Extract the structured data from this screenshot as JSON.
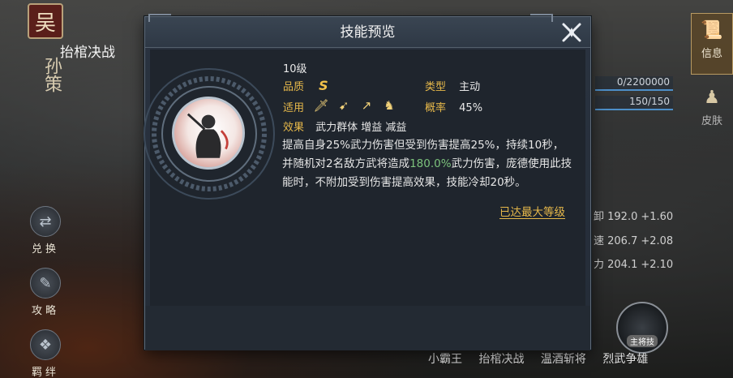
{
  "background": {
    "hero": {
      "seal_char": "吴",
      "name": "孙策"
    },
    "side_buttons": [
      {
        "label": "兑换",
        "icon": "exchange-icon"
      },
      {
        "label": "攻略",
        "icon": "strategy-icon"
      },
      {
        "label": "羁绊",
        "icon": "bond-icon"
      }
    ],
    "right_tabs": [
      {
        "label": "信息",
        "icon": "scroll-icon"
      },
      {
        "label": "皮肤",
        "icon": "figure-icon"
      }
    ],
    "bars": [
      {
        "text": "0/2200000"
      },
      {
        "text": "150/150"
      }
    ],
    "stats": [
      {
        "value": "卸 192.0",
        "delta": "+1.60"
      },
      {
        "value": "速 206.7",
        "delta": "+2.08"
      },
      {
        "value": "力 204.1",
        "delta": "+2.10"
      }
    ],
    "skill_tabs": [
      "小霸王",
      "抬棺决战",
      "温酒斩将",
      "烈武争雄"
    ],
    "lord_skill_badge": "主将技"
  },
  "modal": {
    "title": "技能预览",
    "skill_name": "抬棺决战",
    "level": "10级",
    "quality_label": "品质",
    "quality_value": "S",
    "type_label": "类型",
    "type_value": "主动",
    "applies_label": "适用",
    "weapons": [
      "sword-icon",
      "bow-icon",
      "spear-icon",
      "horse-icon"
    ],
    "chance_label": "概率",
    "chance_value": "45%",
    "effect_label": "效果",
    "effect_tags": "武力群体 增益 减益",
    "desc_part1": "提高自身25%武力伤害但受到伤害提高25%，持续10秒，并随机对2名敌方武将造成",
    "desc_highlight": "180.0%",
    "desc_part2": "武力伤害，庞德使用此技能时，不附加受到伤害提高效果，技能冷却20秒。",
    "max_level": "已达最大等级"
  },
  "colors": {
    "accent_gold": "#e6b84a",
    "highlight_green": "#7cc27c",
    "modal_bg": "#242c37"
  }
}
